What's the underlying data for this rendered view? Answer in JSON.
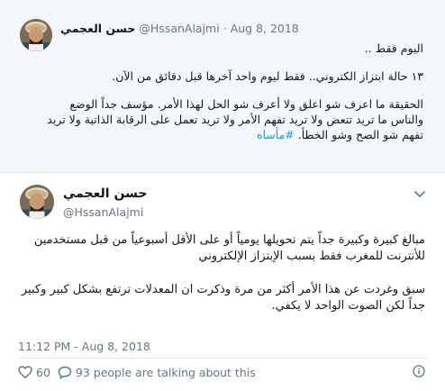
{
  "quoted_tweet": {
    "display_name": "حسن العجمي",
    "handle": "@HssanAlajmi",
    "separator": "·",
    "date": "Aug 8, 2018",
    "paragraphs": [
      "اليوم فقط ..",
      "١٣ حالة ابتزاز الكتروني.. فقط ليوم واحد آخرها قبل دقائق من الآن.",
      "الحقيقة ما اعرف شو اعلق ولا أعرف شو الحل لهذا الأمر. مؤسف جداً الوضع والناس ما تريد تتعض ولا تريد تفهم الأمر ولا تريد تعمل على الرقابة الذاتية ولا تريد تفهم شو الصح وشو الخطأ."
    ],
    "hashtag": "#مأساه"
  },
  "main_tweet": {
    "display_name": "حسن العجمي",
    "handle": "@HssanAlajmi",
    "paragraphs": [
      "مبالغ كبيرة وكبيرة جداً يتم تحويلها يومياً أو على الأقل أسبوعياً من قبل مستخدمين للأنترنت للمغرب فقط بسبب الإبتزاز الإلكتروني",
      "سبق وغردت عن هذا الأمر أكثر من مرة وذكرت ان المعدلات ترتفع بشكل كبير وكبير جداً لكن الصوت الواحد لا يكفي."
    ],
    "timestamp": "11:12 PM - Aug 8, 2018",
    "likes": "60",
    "people_talking": "93 people are talking about this"
  },
  "colors": {
    "accent": "#1b95e0",
    "muted": "#657786",
    "text": "#14171a",
    "quoted_bg": "#f5f8fa",
    "border": "#e1e8ed"
  },
  "icons": [
    "heart-icon",
    "speech-bubble-icon",
    "info-icon",
    "chevron-down-icon",
    "avatar"
  ]
}
